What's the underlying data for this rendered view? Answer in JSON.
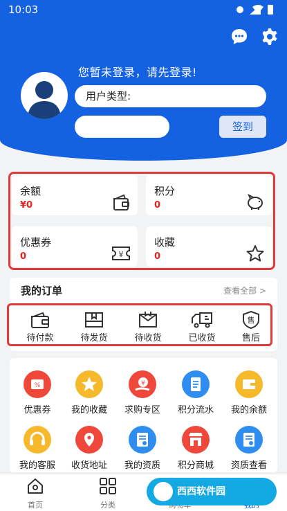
{
  "status_bar": {
    "time": "10:03"
  },
  "header": {
    "login_tip": "您暂未登录，请先登录!",
    "user_type_label": "用户类型:",
    "signin_label": "签到"
  },
  "stats": [
    {
      "label": "余额",
      "value": "¥0",
      "icon": "wallet-icon"
    },
    {
      "label": "积分",
      "value": "0",
      "icon": "piggy-bank-icon"
    },
    {
      "label": "优惠券",
      "value": "0",
      "icon": "coupon-icon"
    },
    {
      "label": "收藏",
      "value": "0",
      "icon": "star-icon"
    }
  ],
  "orders": {
    "title": "我的订单",
    "view_all": "查看全部 >",
    "items": [
      {
        "label": "待付款",
        "icon": "wallet-icon"
      },
      {
        "label": "待发货",
        "icon": "box-icon"
      },
      {
        "label": "待收货",
        "icon": "package-icon"
      },
      {
        "label": "已收货",
        "icon": "truck-icon"
      },
      {
        "label": "售后",
        "icon": "shield-icon"
      }
    ]
  },
  "services": [
    {
      "label": "优惠券",
      "color": "#f0473b",
      "icon": "coupon-icon"
    },
    {
      "label": "我的收藏",
      "color": "#f5b92b",
      "icon": "star-icon"
    },
    {
      "label": "求购专区",
      "color": "#f0473b",
      "icon": "hand-coin-icon"
    },
    {
      "label": "积分流水",
      "color": "#2f8df0",
      "icon": "document-icon"
    },
    {
      "label": "我的余额",
      "color": "#f5b92b",
      "icon": "wallet-icon"
    },
    {
      "label": "我的客服",
      "color": "#f5b92b",
      "icon": "headset-icon"
    },
    {
      "label": "收货地址",
      "color": "#f0473b",
      "icon": "location-icon"
    },
    {
      "label": "我的资质",
      "color": "#2f8df0",
      "icon": "certificate-icon"
    },
    {
      "label": "积分商城",
      "color": "#f0473b",
      "icon": "store-icon"
    },
    {
      "label": "资质查看",
      "color": "#2f8df0",
      "icon": "certificate-icon"
    }
  ],
  "tabs": [
    {
      "label": "首页",
      "icon": "home-icon"
    },
    {
      "label": "分类",
      "icon": "category-icon"
    },
    {
      "label": "购物车",
      "icon": "cart-icon"
    },
    {
      "label": "我的",
      "icon": "user-icon"
    }
  ],
  "watermark": "西西软件园",
  "colors": {
    "primary": "#1462e2",
    "accent_red": "#e0231d",
    "highlight_border": "#e03a3a"
  }
}
